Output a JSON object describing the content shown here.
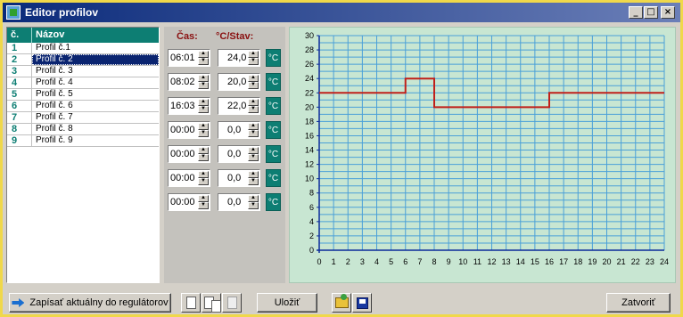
{
  "window": {
    "title": "Editor profilov",
    "buttons": [
      "_",
      "□",
      "×"
    ]
  },
  "profile_list": {
    "headers": {
      "num": "č.",
      "name": "Názov"
    },
    "selected_index": 1,
    "items": [
      {
        "num": "1",
        "name": "Profil č.1"
      },
      {
        "num": "2",
        "name": "Profil č. 2"
      },
      {
        "num": "3",
        "name": "Profil č. 3"
      },
      {
        "num": "4",
        "name": "Profil č. 4"
      },
      {
        "num": "5",
        "name": "Profil č. 5"
      },
      {
        "num": "6",
        "name": "Profil č. 6"
      },
      {
        "num": "7",
        "name": "Profil č. 7"
      },
      {
        "num": "8",
        "name": "Profil č. 8"
      },
      {
        "num": "9",
        "name": "Profil č. 9"
      }
    ]
  },
  "editor": {
    "time_header": "Čas:",
    "temp_header": "°C/Stav:",
    "unit_label": "°C",
    "rows": [
      {
        "time": "06:01",
        "temp": "24,0"
      },
      {
        "time": "08:02",
        "temp": "20,0"
      },
      {
        "time": "16:03",
        "temp": "22,0"
      },
      {
        "time": "00:00",
        "temp": "0,0"
      },
      {
        "time": "00:00",
        "temp": "0,0"
      },
      {
        "time": "00:00",
        "temp": "0,0"
      },
      {
        "time": "00:00",
        "temp": "0,0"
      }
    ]
  },
  "chart_data": {
    "type": "line",
    "xlim": [
      0,
      24
    ],
    "ylim": [
      0,
      30
    ],
    "x_ticks": [
      "0",
      "1",
      "2",
      "3",
      "4",
      "5",
      "6",
      "7",
      "8",
      "9",
      "10",
      "11",
      "12",
      "13",
      "14",
      "15",
      "16",
      "17",
      "18",
      "19",
      "20",
      "21",
      "22",
      "23",
      "24"
    ],
    "y_ticks": [
      "0",
      "2",
      "4",
      "6",
      "8",
      "10",
      "12",
      "14",
      "16",
      "18",
      "20",
      "22",
      "24",
      "26",
      "28",
      "30"
    ],
    "grid": true,
    "step": true,
    "series": [
      {
        "color": "#c0201a",
        "x": [
          0,
          6,
          8,
          16,
          24
        ],
        "y": [
          22,
          24,
          20,
          22,
          22
        ]
      }
    ],
    "colors": {
      "background": "#c8e6d2",
      "grid": "#4aa0d8",
      "axis": "#0a2a9a"
    }
  },
  "toolbar": {
    "write_label": "Zapísať aktuálny do regulátorov",
    "save_label": "Uložiť",
    "close_label": "Zatvoriť",
    "icons": [
      "new-document-icon",
      "copy-icon",
      "paste-icon",
      "open-folder-icon",
      "save-disk-icon"
    ]
  }
}
